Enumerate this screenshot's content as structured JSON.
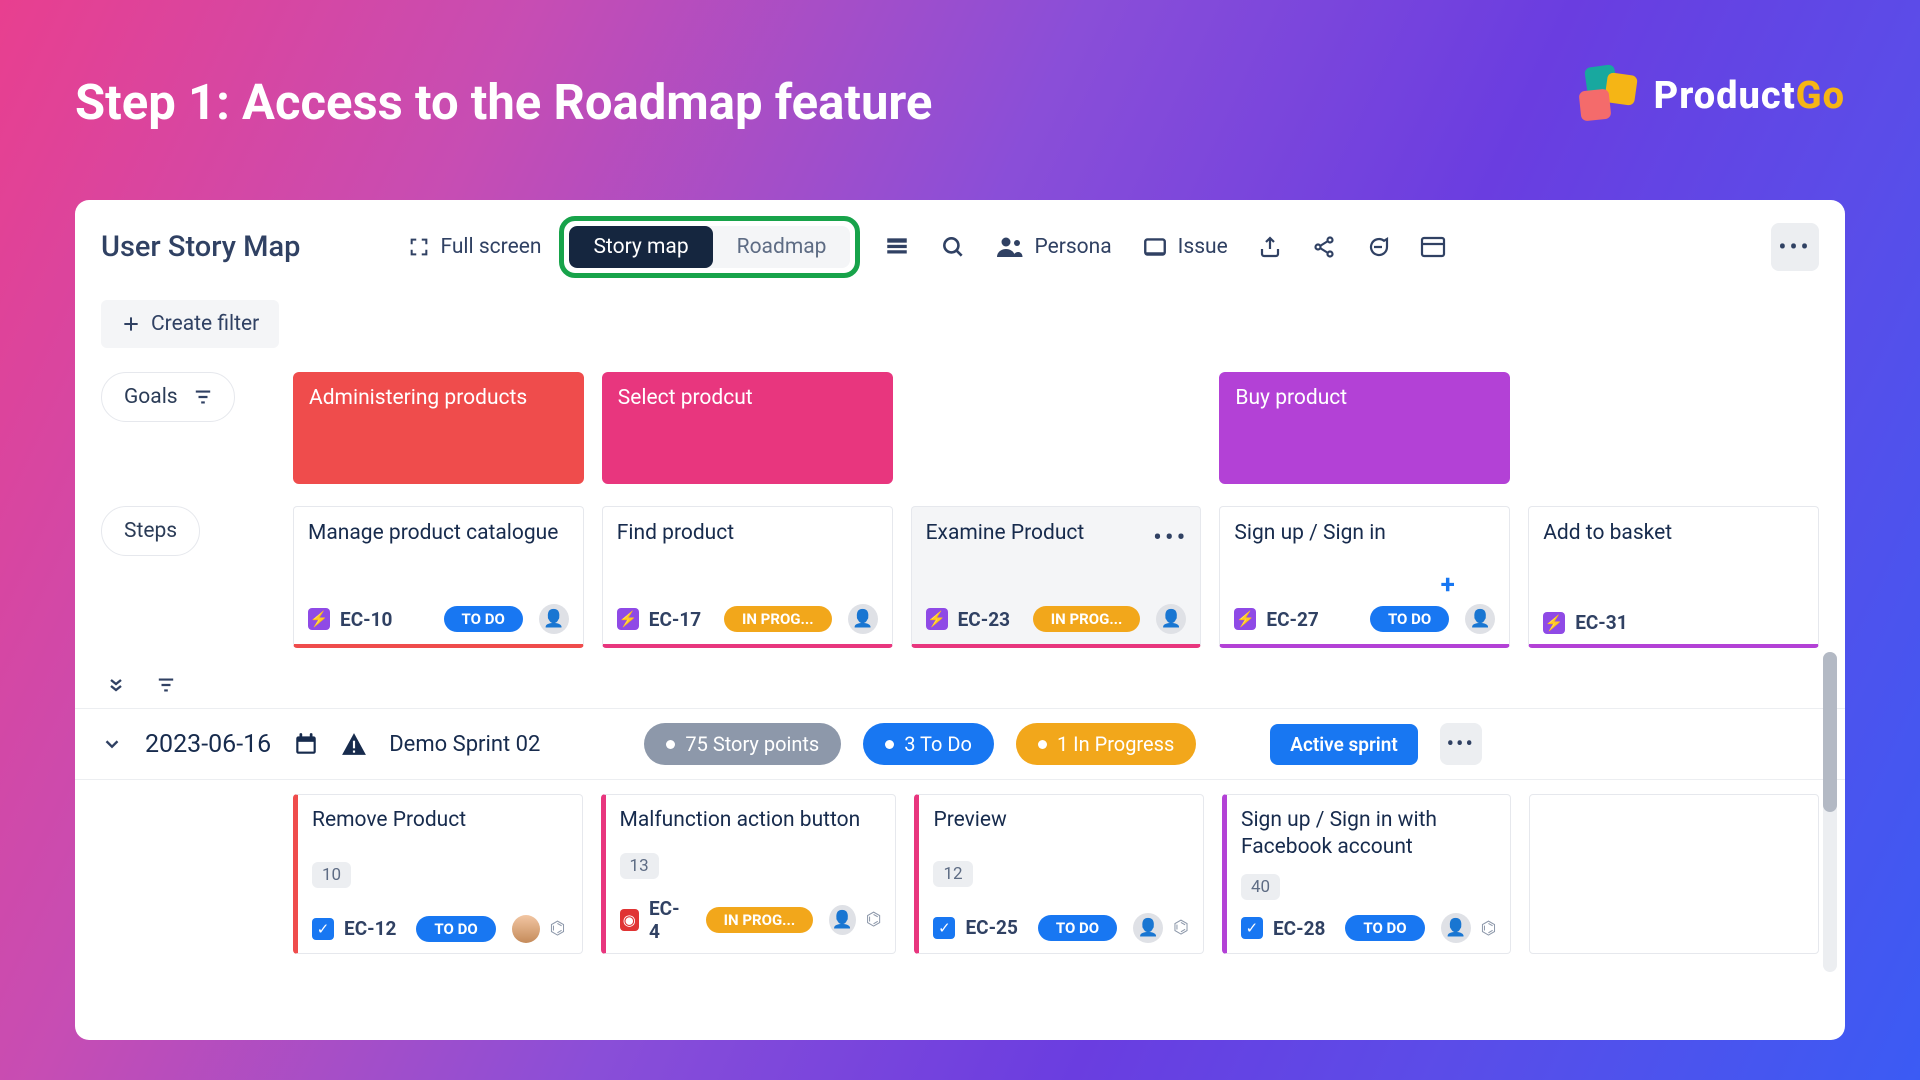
{
  "slide_title": "Step 1: Access to the Roadmap feature",
  "brand": {
    "name_part1": "Product",
    "name_part2": "Go"
  },
  "header": {
    "title": "User Story Map",
    "full_screen": "Full screen",
    "tabs": {
      "story_map": "Story map",
      "roadmap": "Roadmap"
    },
    "persona": "Persona",
    "issue": "Issue"
  },
  "create_filter": "Create filter",
  "lane_labels": {
    "goals": "Goals",
    "steps": "Steps"
  },
  "goals": [
    {
      "title": "Administering products",
      "tone": "red"
    },
    {
      "title": "Select prodcut",
      "tone": "pink"
    },
    {
      "title": "",
      "tone": "empty"
    },
    {
      "title": "Buy product",
      "tone": "purple"
    },
    {
      "title": "",
      "tone": "empty"
    }
  ],
  "steps": [
    {
      "title": "Manage product catalogue",
      "key": "EC-10",
      "status": "TO DO",
      "status_kind": "todo",
      "tone": "red"
    },
    {
      "title": "Find product",
      "key": "EC-17",
      "status": "IN PROG...",
      "status_kind": "prog",
      "tone": "pink"
    },
    {
      "title": "Examine Product",
      "key": "EC-23",
      "status": "IN PROG...",
      "status_kind": "prog",
      "tone": "pink",
      "hover": true
    },
    {
      "title": "Sign up / Sign in",
      "key": "EC-27",
      "status": "TO DO",
      "status_kind": "todo",
      "tone": "purple"
    },
    {
      "title": "Add to basket",
      "key": "EC-31",
      "status": "",
      "status_kind": "",
      "tone": "purple"
    }
  ],
  "sprint": {
    "date": "2023-06-16",
    "name": "Demo Sprint 02",
    "story_points": "75 Story points",
    "todo": "3 To Do",
    "in_progress": "1 In Progress",
    "active": "Active sprint"
  },
  "stories": [
    {
      "title": "Remove Product",
      "pts": "10",
      "key": "EC-12",
      "status": "TO DO",
      "status_kind": "todo",
      "tone": "red",
      "icon": "tick",
      "has_avatar": true
    },
    {
      "title": "Malfunction action button",
      "pts": "13",
      "key": "EC-4",
      "status": "IN PROG...",
      "status_kind": "prog",
      "tone": "pink",
      "icon": "bug"
    },
    {
      "title": "Preview",
      "pts": "12",
      "key": "EC-25",
      "status": "TO DO",
      "status_kind": "todo",
      "tone": "pink",
      "icon": "tick"
    },
    {
      "title": "Sign up / Sign in with Facebook account",
      "pts": "40",
      "key": "EC-28",
      "status": "TO DO",
      "status_kind": "todo",
      "tone": "purple",
      "icon": "tick"
    }
  ]
}
